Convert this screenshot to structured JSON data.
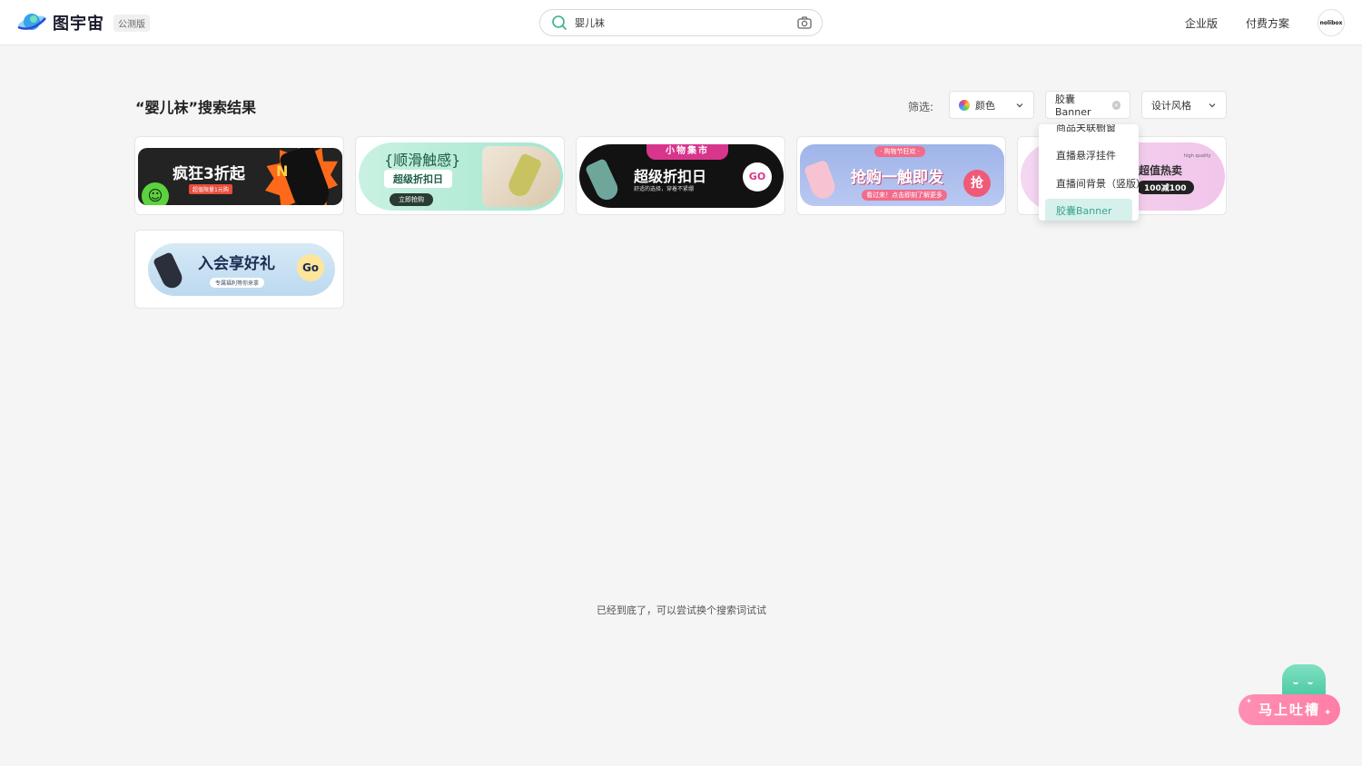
{
  "header": {
    "logo_text": "图宇宙",
    "beta_badge": "公测版",
    "search": {
      "value": "婴儿袜",
      "placeholder": ""
    },
    "nav": {
      "enterprise": "企业版",
      "pricing": "付费方案"
    },
    "avatar_text": "nolibox"
  },
  "results": {
    "title": "“婴儿袜”搜索结果",
    "filter_label": "筛选:",
    "filters": {
      "color": "颜色",
      "type": "胶囊Banner",
      "style": "设计风格"
    }
  },
  "dropdown": {
    "items": [
      "商品关联橱窗",
      "直播悬浮挂件",
      "直播间背景（竖版）",
      "胶囊Banner"
    ],
    "selected": "胶囊Banner"
  },
  "cards": [
    {
      "title": "疯狂3折起",
      "subtitle": "超值限量1元购",
      "badge": "N"
    },
    {
      "title": "{顺滑触感}",
      "subtitle": "超级折扣日",
      "button": "立即抢购"
    },
    {
      "top": "小物集市",
      "title": "超级折扣日",
      "subtitle": "舒适的选择，穿着不紧绷",
      "button": "GO"
    },
    {
      "top": "· 购物节狂欢 ·",
      "title": "抢购一触即发",
      "subtitle": "看过来！点击即刻了解更多",
      "button": "抢"
    },
    {
      "small": "high quality",
      "title": "超值热卖",
      "price": "100减100"
    },
    {
      "title": "入会享好礼",
      "subtitle": "专属福利等你来拿",
      "button": "Go"
    }
  ],
  "end_text": "已经到底了，可以尝试换个搜索词试试",
  "feedback": {
    "label": "马上吐槽"
  },
  "colors": {
    "accent": "#3aa38b",
    "accent_bg": "#d6f1eb",
    "feedback_pink": "#ff7ea6"
  }
}
